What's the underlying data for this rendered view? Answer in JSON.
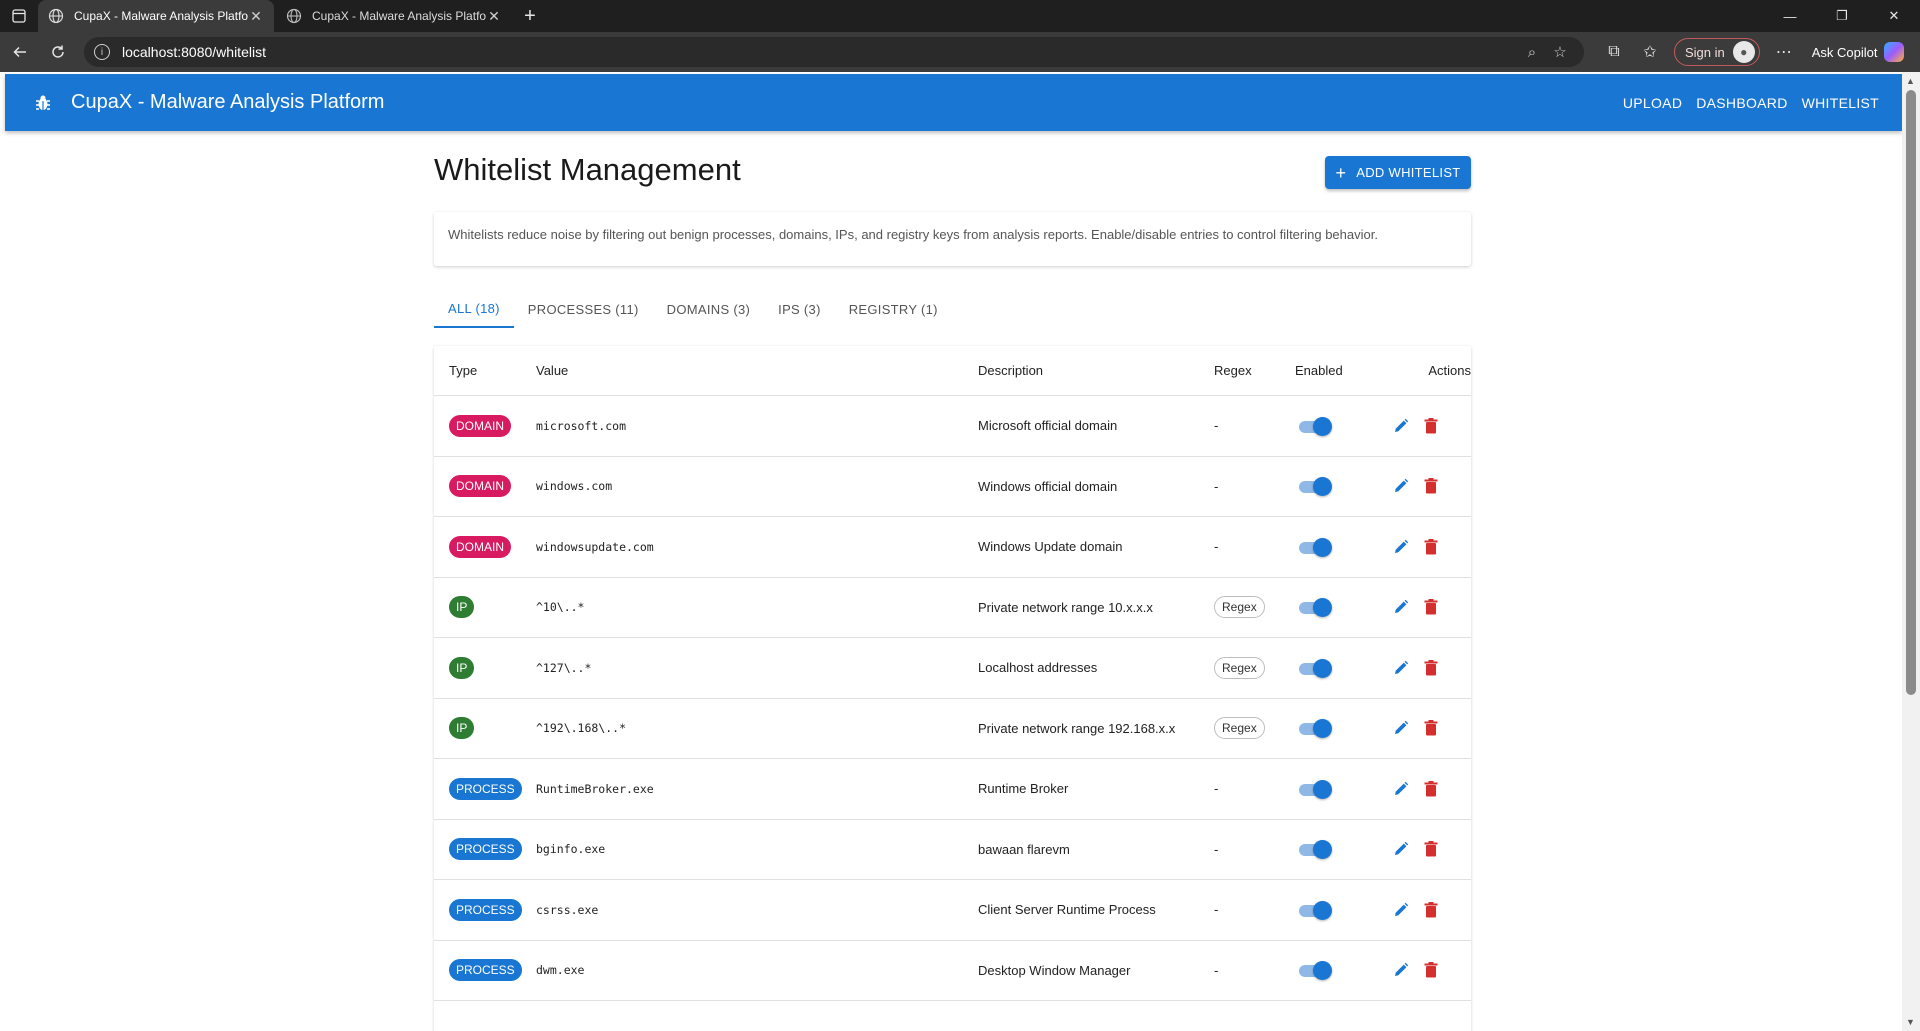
{
  "browser": {
    "tabs": [
      {
        "title": "CupaX - Malware Analysis Platform",
        "active": true
      },
      {
        "title": "CupaX - Malware Analysis Platform",
        "active": false
      }
    ],
    "url": "localhost:8080/whitelist",
    "sign_in": "Sign in",
    "copilot": "Ask Copilot"
  },
  "app": {
    "brand": "CupaX - Malware Analysis Platform",
    "nav": [
      "UPLOAD",
      "DASHBOARD",
      "WHITELIST"
    ]
  },
  "page": {
    "title": "Whitelist Management",
    "add_button": "ADD WHITELIST",
    "info": "Whitelists reduce noise by filtering out benign processes, domains, IPs, and registry keys from analysis reports. Enable/disable entries to control filtering behavior."
  },
  "tabs": [
    "ALL (18)",
    "PROCESSES (11)",
    "DOMAINS (3)",
    "IPS (3)",
    "REGISTRY (1)"
  ],
  "table": {
    "headers": {
      "type": "Type",
      "value": "Value",
      "description": "Description",
      "regex": "Regex",
      "enabled": "Enabled",
      "actions": "Actions"
    },
    "rows": [
      {
        "type": "DOMAIN",
        "value": "microsoft.com",
        "description": "Microsoft official domain",
        "regex": "-"
      },
      {
        "type": "DOMAIN",
        "value": "windows.com",
        "description": "Windows official domain",
        "regex": "-"
      },
      {
        "type": "DOMAIN",
        "value": "windowsupdate.com",
        "description": "Windows Update domain",
        "regex": "-"
      },
      {
        "type": "IP",
        "value": "^10\\..*",
        "description": "Private network range 10.x.x.x",
        "regex": "Regex"
      },
      {
        "type": "IP",
        "value": "^127\\..*",
        "description": "Localhost addresses",
        "regex": "Regex"
      },
      {
        "type": "IP",
        "value": "^192\\.168\\..*",
        "description": "Private network range 192.168.x.x",
        "regex": "Regex"
      },
      {
        "type": "PROCESS",
        "value": "RuntimeBroker.exe",
        "description": "Runtime Broker",
        "regex": "-"
      },
      {
        "type": "PROCESS",
        "value": "bginfo.exe",
        "description": "bawaan flarevm",
        "regex": "-"
      },
      {
        "type": "PROCESS",
        "value": "csrss.exe",
        "description": "Client Server Runtime Process",
        "regex": "-"
      },
      {
        "type": "PROCESS",
        "value": "dwm.exe",
        "description": "Desktop Window Manager",
        "regex": "-"
      }
    ]
  },
  "colors": {
    "primary": "#1976d2",
    "domain": "#d81b60",
    "ip": "#2e7d32",
    "delete": "#d32f2f"
  }
}
